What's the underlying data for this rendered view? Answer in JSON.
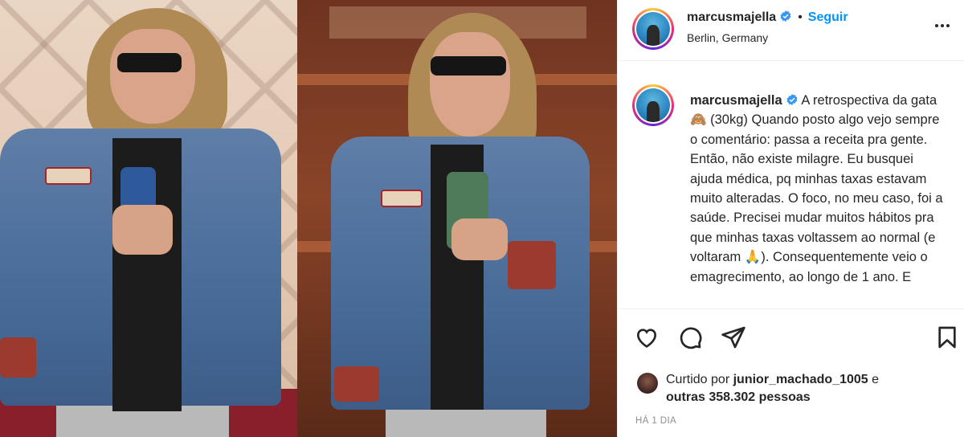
{
  "post": {
    "username": "marcusmajella",
    "verified": true,
    "follow_label": "Seguir",
    "location": "Berlin, Germany",
    "caption": "A retrospectiva da gata 🙈 (30kg) Quando posto algo vejo sempre o comentário: passa a receita pra gente. Então, não existe milagre. Eu busquei ajuda médica, pq minhas taxas estavam muito alteradas. O foco, no meu caso, foi a saúde. Precisei mudar muitos hábitos pra que minhas taxas voltassem ao normal (e voltaram 🙏). Consequentemente veio o emagrecimento, ao longo de 1 ano. E",
    "liked_prefix": "Curtido por",
    "liked_by": "junior_machado_1005",
    "liked_mid": "e",
    "liked_others": "outras 358.302 pessoas",
    "timestamp": "HÁ 1 DIA"
  },
  "icons": {
    "like": "heart-icon",
    "comment": "comment-icon",
    "share": "share-icon",
    "save": "bookmark-icon",
    "more": "more-icon",
    "verified": "verified-badge-icon"
  },
  "colors": {
    "accent": "#0095f6",
    "text": "#262626",
    "muted": "#8e8e8e",
    "verified": "#3897f0"
  }
}
